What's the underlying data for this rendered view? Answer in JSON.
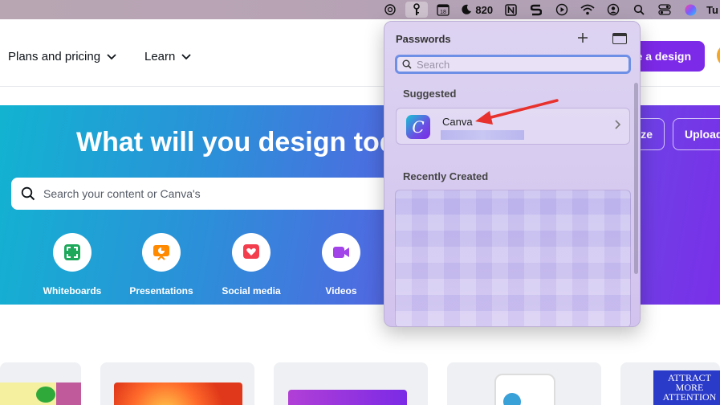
{
  "menubar": {
    "icons": [
      "openai-icon",
      "keys-icon",
      "calendar-icon",
      "weather-icon",
      "notion-icon",
      "s-app-icon",
      "play-icon",
      "wifi-icon",
      "user-icon",
      "search-icon",
      "control-center-icon",
      "siri-icon"
    ],
    "calendar_day": "18",
    "weather_value": "820",
    "clock_text": "Tu"
  },
  "nav": {
    "items": [
      {
        "label": "Plans and pricing"
      },
      {
        "label": "Learn"
      }
    ],
    "create_button": "e a design"
  },
  "hero": {
    "title": "What will you design toda",
    "search_placeholder": "Search your content or Canva's",
    "buttons": [
      "ze",
      "Upload"
    ],
    "categories": [
      {
        "label": "Whiteboards",
        "color": "#1ea85a"
      },
      {
        "label": "Presentations",
        "color": "#ff8a00"
      },
      {
        "label": "Social media",
        "color": "#f23e4d"
      },
      {
        "label": "Videos",
        "color": "#a143e8"
      }
    ]
  },
  "passwords": {
    "title": "Passwords",
    "search_placeholder": "Search",
    "suggested_label": "Suggested",
    "suggested_item": {
      "name": "Canva"
    },
    "recent_label": "Recently Created"
  },
  "templates": {
    "attract_text_1": "ATTRACT",
    "attract_text_2": "MORE",
    "attract_text_3": "ATTENTION"
  },
  "colors": {
    "accent": "#7d2ae8",
    "arrow": "#e8312c",
    "search_focus": "#6e8fe6"
  }
}
